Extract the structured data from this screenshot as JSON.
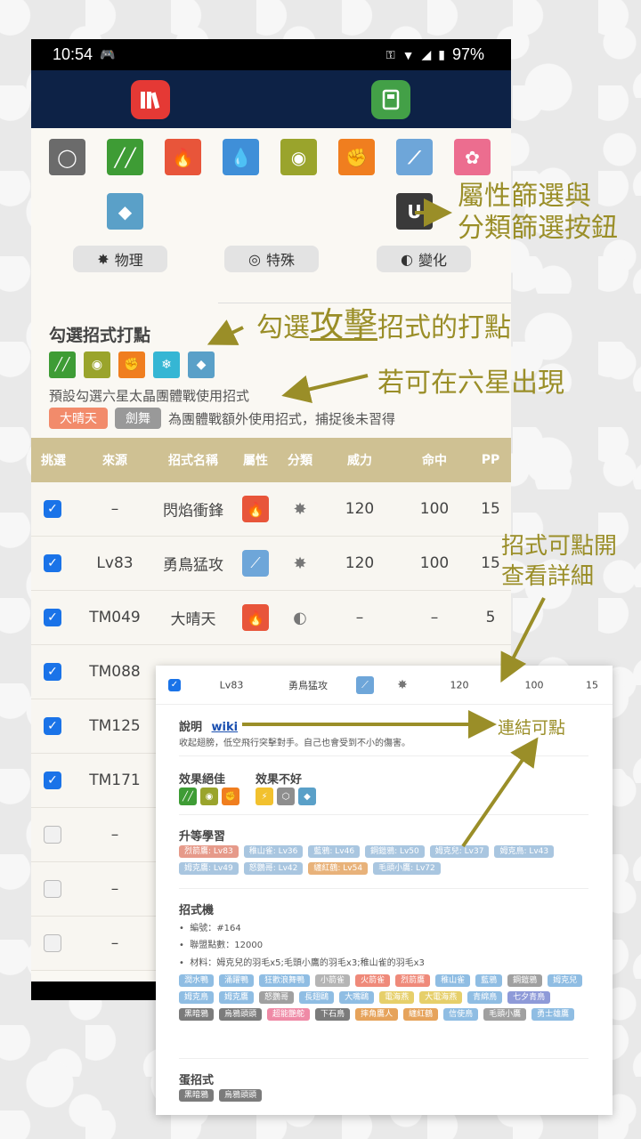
{
  "status": {
    "time": "10:54",
    "battery": "97%"
  },
  "types": [
    {
      "name": "normal",
      "color": "#6b6b6b",
      "glyph": "◯",
      "col": 0,
      "line": 0
    },
    {
      "name": "grass",
      "color": "#3e9c35",
      "glyph": "╱╱",
      "col": 1,
      "line": 0
    },
    {
      "name": "fire",
      "color": "#e8553a",
      "glyph": "🔥",
      "col": 2,
      "line": 0
    },
    {
      "name": "water",
      "color": "#3f8fd8",
      "glyph": "💧",
      "col": 3,
      "line": 0
    },
    {
      "name": "bug",
      "color": "#9aa42c",
      "glyph": "◉",
      "col": 4,
      "line": 0
    },
    {
      "name": "fighting",
      "color": "#f07e1f",
      "glyph": "✊",
      "col": 5,
      "line": 0
    },
    {
      "name": "flying",
      "color": "#6ea6d9",
      "glyph": "⟋",
      "col": 6,
      "line": 0
    },
    {
      "name": "fairy",
      "color": "#ec6d8f",
      "glyph": "✿",
      "col": 7,
      "line": 0
    },
    {
      "name": "rock",
      "color": "#5aa0c8",
      "glyph": "◆",
      "col": 1,
      "line": 1
    },
    {
      "name": "dark",
      "color": "#3a3a3a",
      "glyph": "U",
      "col": 6,
      "line": 1
    }
  ],
  "categories": [
    {
      "label": "物理",
      "glyph": "✸"
    },
    {
      "label": "特殊",
      "glyph": "◎"
    },
    {
      "label": "變化",
      "glyph": "◐"
    }
  ],
  "section": {
    "title": "勾選招式打點",
    "check_types": [
      {
        "name": "grass",
        "color": "#3e9c35",
        "glyph": "╱╱"
      },
      {
        "name": "bug",
        "color": "#9aa42c",
        "glyph": "◉"
      },
      {
        "name": "fighting",
        "color": "#f07e1f",
        "glyph": "✊"
      },
      {
        "name": "ice",
        "color": "#35b6d4",
        "glyph": "❄"
      },
      {
        "name": "rock",
        "color": "#5aa0c8",
        "glyph": "◆"
      }
    ],
    "preset": "預設勾選六星太晶團體戰使用招式",
    "tag1": "大晴天",
    "tag2": "劍舞",
    "tag_note": "為團體戰額外使用招式，捕捉後未習得"
  },
  "table": {
    "headers": [
      "挑選",
      "來源",
      "招式名稱",
      "屬性",
      "分類",
      "威力",
      "命中",
      "PP"
    ],
    "rows": [
      {
        "checked": true,
        "source": "–",
        "name": "閃焰衝鋒",
        "type_color": "#e8553a",
        "type_glyph": "🔥",
        "cat": "✸",
        "power": "120",
        "acc": "100",
        "pp": "15"
      },
      {
        "checked": true,
        "source": "Lv83",
        "name": "勇鳥猛攻",
        "type_color": "#6ea6d9",
        "type_glyph": "⟋",
        "cat": "✸",
        "power": "120",
        "acc": "100",
        "pp": "15"
      },
      {
        "checked": true,
        "source": "TM049",
        "name": "大晴天",
        "type_color": "#e8553a",
        "type_glyph": "🔥",
        "cat": "◐",
        "power": "–",
        "acc": "–",
        "pp": "5"
      },
      {
        "checked": true,
        "source": "TM088",
        "name": "",
        "type_color": "",
        "type_glyph": "",
        "cat": "",
        "power": "",
        "acc": "",
        "pp": ""
      },
      {
        "checked": true,
        "source": "TM125",
        "name": "",
        "type_color": "",
        "type_glyph": "",
        "cat": "",
        "power": "",
        "acc": "",
        "pp": ""
      },
      {
        "checked": true,
        "source": "TM171",
        "name": "",
        "type_color": "",
        "type_glyph": "",
        "cat": "",
        "power": "",
        "acc": "",
        "pp": ""
      },
      {
        "checked": false,
        "source": "–",
        "name": "",
        "type_color": "",
        "type_glyph": "",
        "cat": "",
        "power": "",
        "acc": "",
        "pp": ""
      },
      {
        "checked": false,
        "source": "–",
        "name": "",
        "type_color": "",
        "type_glyph": "",
        "cat": "",
        "power": "",
        "acc": "",
        "pp": ""
      },
      {
        "checked": false,
        "source": "–",
        "name": "",
        "type_color": "",
        "type_glyph": "",
        "cat": "",
        "power": "",
        "acc": "",
        "pp": ""
      }
    ]
  },
  "popup": {
    "source": "Lv83",
    "name": "勇鳥猛攻",
    "power": "120",
    "acc": "100",
    "pp": "15",
    "desc_title": "說明",
    "wiki": "wiki",
    "desc": "收起翅膀，低空飛行突擊對手。自己也會受到不小的傷害。",
    "eff_good": "效果絕佳",
    "eff_bad": "效果不好",
    "good_types": [
      {
        "color": "#3e9c35",
        "glyph": "╱╱"
      },
      {
        "color": "#9aa42c",
        "glyph": "◉"
      },
      {
        "color": "#f07e1f",
        "glyph": "✊"
      }
    ],
    "bad_types": [
      {
        "color": "#f2c12e",
        "glyph": "⚡"
      },
      {
        "color": "#8e8e8e",
        "glyph": "⬡"
      },
      {
        "color": "#5aa0c8",
        "glyph": "◆"
      }
    ],
    "levelup_title": "升等學習",
    "levelup": [
      {
        "t": "烈箭鷹: Lv83",
        "c": "#e69a8a"
      },
      {
        "t": "稚山雀: Lv36",
        "c": "#a9c6e0"
      },
      {
        "t": "藍鴉: Lv46",
        "c": "#a9c6e0"
      },
      {
        "t": "鋼鎧鴉: Lv50",
        "c": "#a9c6e0"
      },
      {
        "t": "姆克兒: Lv37",
        "c": "#a9c6e0"
      },
      {
        "t": "姆克鳥: Lv43",
        "c": "#a9c6e0"
      },
      {
        "t": "姆克鷹: Lv49",
        "c": "#a9c6e0"
      },
      {
        "t": "怒鸚哥: Lv42",
        "c": "#a9c6e0"
      },
      {
        "t": "纏紅鶴: Lv54",
        "c": "#e8b27a"
      },
      {
        "t": "毛頭小鷹: Lv72",
        "c": "#a9c6e0"
      }
    ],
    "tm_title": "招式機",
    "tm_no": "編號：#164",
    "tm_points": "聯盟點數：12000",
    "tm_mats": "材料：姆克兒的羽毛x5;毛頭小鷹的羽毛x3;稚山雀的羽毛x3",
    "tm_list": [
      {
        "t": "潤水鴨",
        "c": "#8fbde3"
      },
      {
        "t": "涌躍鴨",
        "c": "#8fbde3"
      },
      {
        "t": "狂歡浪舞鴨",
        "c": "#8fbde3"
      },
      {
        "t": "小箭雀",
        "c": "#b5b5b5"
      },
      {
        "t": "火箭雀",
        "c": "#ef8a7a"
      },
      {
        "t": "烈箭鷹",
        "c": "#ef8a7a"
      },
      {
        "t": "稚山雀",
        "c": "#8fbde3"
      },
      {
        "t": "藍鴉",
        "c": "#8fbde3"
      },
      {
        "t": "鋼鎧鴉",
        "c": "#a0a0a0"
      },
      {
        "t": "姆克兒",
        "c": "#8fbde3"
      },
      {
        "t": "姆克鳥",
        "c": "#8fbde3"
      },
      {
        "t": "姆克鷹",
        "c": "#8fbde3"
      },
      {
        "t": "怒鸚哥",
        "c": "#a0a0a0"
      },
      {
        "t": "長翅鷗",
        "c": "#8fbde3"
      },
      {
        "t": "大嘴鷗",
        "c": "#8fbde3"
      },
      {
        "t": "電海燕",
        "c": "#e6cf6a"
      },
      {
        "t": "大電海燕",
        "c": "#e6cf6a"
      },
      {
        "t": "青綿鳥",
        "c": "#8fbde3"
      },
      {
        "t": "七夕青鳥",
        "c": "#8e9ad8"
      },
      {
        "t": "黑暗鴉",
        "c": "#7b7b7b"
      },
      {
        "t": "烏鴉頭頭",
        "c": "#7b7b7b"
      },
      {
        "t": "超能艷鴕",
        "c": "#ef8aa6"
      },
      {
        "t": "下石鳥",
        "c": "#7b7b7b"
      },
      {
        "t": "摔角鷹人",
        "c": "#e6a35b"
      },
      {
        "t": "纏紅鶴",
        "c": "#e6a35b"
      },
      {
        "t": "信使鳥",
        "c": "#8fbde3"
      },
      {
        "t": "毛頭小鷹",
        "c": "#a0a0a0"
      },
      {
        "t": "勇士雄鷹",
        "c": "#8fbde3"
      }
    ],
    "egg_title": "蛋招式",
    "egg": [
      {
        "t": "黑暗鴉",
        "c": "#7b7b7b"
      },
      {
        "t": "烏鴉頭頭",
        "c": "#7b7b7b"
      }
    ]
  },
  "annotations": {
    "filter": [
      "屬性篩選與",
      "分類篩選按鈕"
    ],
    "check_prefix": "勾選",
    "check_u": "攻擊",
    "check_suffix": "招式的打點",
    "six_star": "若可在六星出現",
    "click_detail": [
      "招式可點開",
      "查看詳細"
    ],
    "link": "連結可點"
  }
}
